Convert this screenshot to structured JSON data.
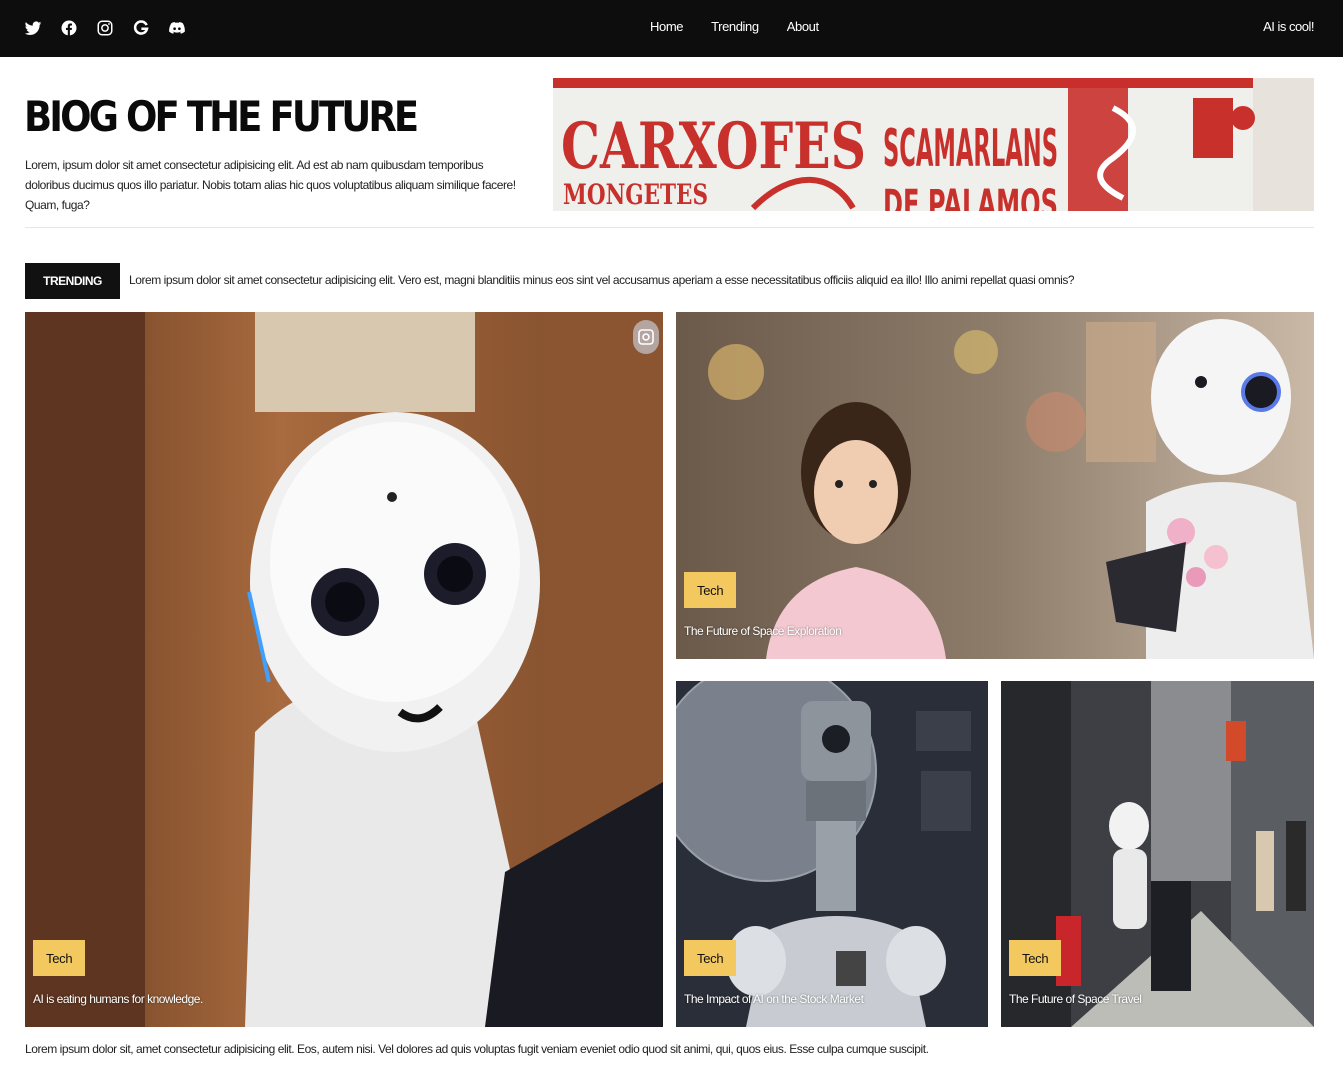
{
  "header": {
    "social_icons": [
      "twitter-icon",
      "facebook-icon",
      "instagram-icon",
      "google-icon",
      "discord-icon"
    ],
    "nav": [
      "Home",
      "Trending",
      "About"
    ],
    "tagline": "AI is cool!"
  },
  "hero": {
    "title": "BIOG OF THE FUTURE",
    "description": "Lorem, ipsum dolor sit amet consectetur adipisicing elit. Ad est ab nam quibusdam temporibus doloribus ducimus quos illo pariatur. Nobis totam alias hic quos voluptatibus aliquam similique facere! Quam, fuga?",
    "banner_text": [
      "CARXOFES",
      "SCAMARLANS",
      "MONGETES",
      "DE PALAMOS"
    ]
  },
  "trending": {
    "badge": "TRENDING",
    "text": "Lorem ipsum dolor sit amet consectetur adipisicing elit. Vero est, magni blanditiis minus eos sint vel accusamus aperiam a esse necessitatibus officiis aliquid ea illo! Illo animi repellat quasi omnis?"
  },
  "cards": [
    {
      "category": "Tech",
      "caption": "AI is eating humans for knowledge."
    },
    {
      "category": "Tech",
      "caption": "The Future of Space Exploration"
    },
    {
      "category": "Tech",
      "caption": "The Impact of AI on the Stock Market"
    },
    {
      "category": "Tech",
      "caption": "The Future of Space Travel"
    }
  ],
  "footer": {
    "text": "Lorem ipsum dolor sit, amet consectetur adipisicing elit. Eos, autem nisi. Vel dolores ad quis voluptas fugit veniam eveniet odio quod sit animi, qui, quos eius. Esse culpa cumque suscipit."
  },
  "colors": {
    "topbar": "#0d0d0d",
    "category_badge": "#f3c85e",
    "trending_badge": "#111111"
  }
}
